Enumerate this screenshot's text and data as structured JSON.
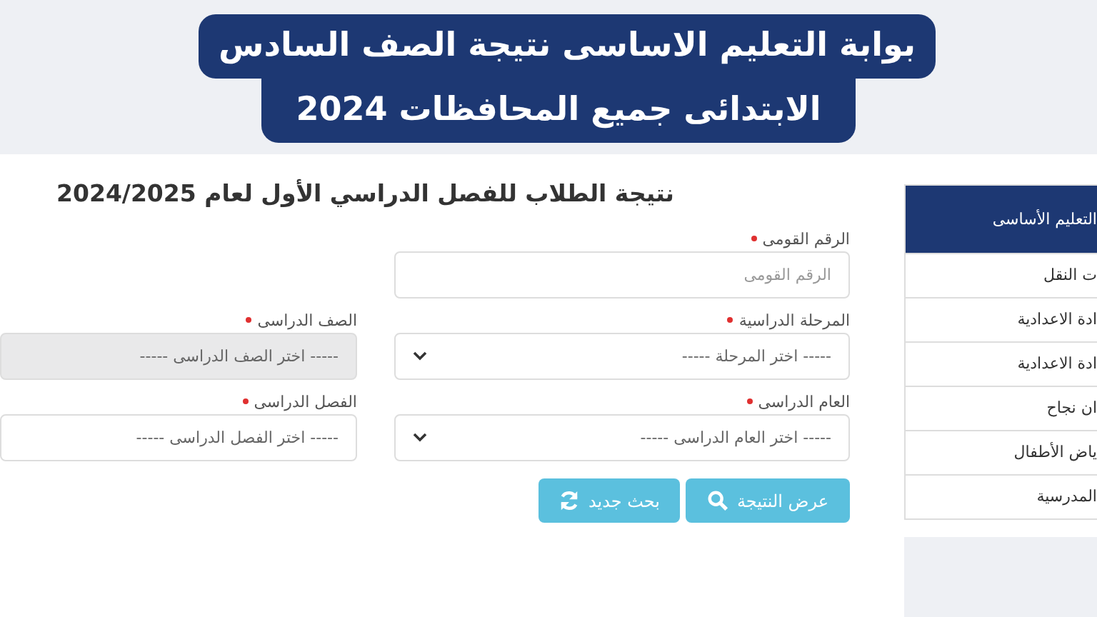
{
  "headline": [
    "بوابة التعليم الاساسى نتيجة الصف السادس",
    "الابتدائى جميع المحافظات 2024"
  ],
  "form": {
    "title": "نتيجة الطلاب للفصل الدراسي  الأول  لعام  2024/2025",
    "rows": [
      [
        {
          "label": "الرقم القومى",
          "required": true,
          "kind": "text",
          "placeholder": "الرقم القومى"
        }
      ],
      [
        {
          "label": "المرحلة الدراسية",
          "required": true,
          "kind": "select",
          "value": "----- اختر المرحلة -----",
          "disabled": false
        },
        {
          "label": "الصف الدراسى",
          "required": true,
          "kind": "select",
          "value": "----- اختر الصف الدراسى -----",
          "disabled": true
        }
      ],
      [
        {
          "label": "العام الدراسى",
          "required": true,
          "kind": "select",
          "value": "----- اختر العام الدراسى -----",
          "disabled": false
        },
        {
          "label": "الفصل الدراسى",
          "required": true,
          "kind": "select",
          "value": "----- اختر الفصل الدراسى -----",
          "disabled": false
        }
      ]
    ],
    "buttons": [
      {
        "label": "عرض النتيجة",
        "kind": "search"
      },
      {
        "label": "بحث جديد",
        "kind": "refresh"
      }
    ]
  },
  "sidebar": {
    "header": "التعليم الأساسى",
    "items": [
      "ت النقل",
      "ادة الاعدادية",
      "ادة الاعدادية",
      "ان نجاح",
      "ياض الأطفال",
      "المدرسية"
    ]
  }
}
